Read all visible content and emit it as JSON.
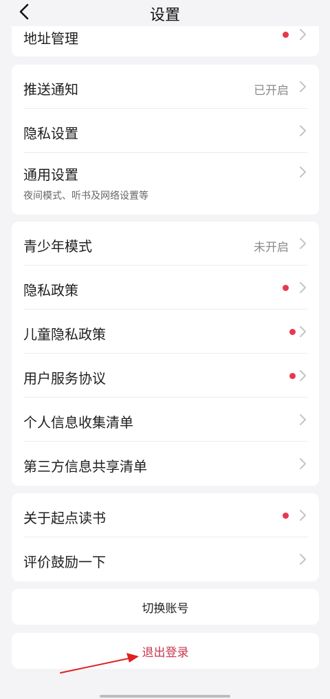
{
  "header": {
    "title": "设置"
  },
  "card1": {
    "address": {
      "label": "地址管理"
    }
  },
  "card2": {
    "push": {
      "label": "推送通知",
      "value": "已开启"
    },
    "privacy_settings": {
      "label": "隐私设置"
    },
    "general": {
      "label": "通用设置",
      "sub": "夜间模式、听书及网络设置等"
    }
  },
  "card3": {
    "youth": {
      "label": "青少年模式",
      "value": "未开启"
    },
    "privacy_policy": {
      "label": "隐私政策"
    },
    "child_privacy": {
      "label": "儿童隐私政策"
    },
    "user_agreement": {
      "label": "用户服务协议"
    },
    "personal_info": {
      "label": "个人信息收集清单"
    },
    "third_party": {
      "label": "第三方信息共享清单"
    }
  },
  "card4": {
    "about": {
      "label": "关于起点读书"
    },
    "rate": {
      "label": "评价鼓励一下"
    }
  },
  "actions": {
    "switch_account": "切换账号",
    "logout": "退出登录"
  },
  "colors": {
    "background": "#f4f4f6",
    "badge": "#e8384f",
    "logout_text": "#c8374d",
    "annotation_arrow": "#e02020"
  }
}
